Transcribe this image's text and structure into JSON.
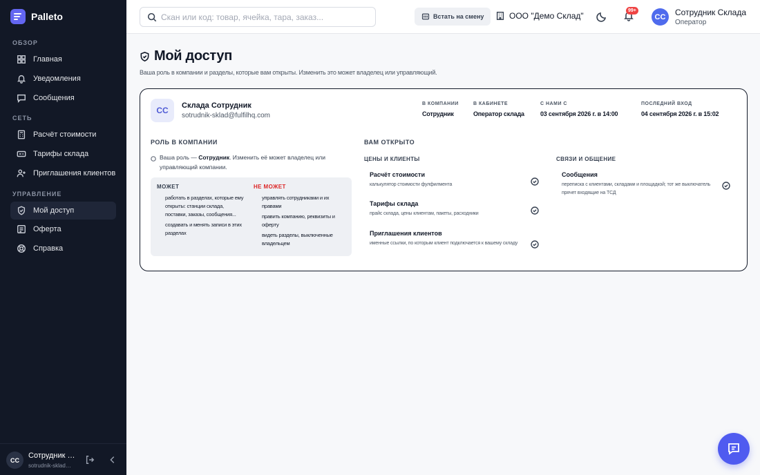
{
  "app": {
    "name": "Palleto"
  },
  "sidebar": {
    "sections": [
      {
        "title": "ОБЗОР",
        "items": [
          {
            "label": "Главная",
            "icon": "grid-icon"
          },
          {
            "label": "Уведомления",
            "icon": "bell-icon"
          },
          {
            "label": "Сообщения",
            "icon": "message-icon"
          }
        ]
      },
      {
        "title": "СЕТЬ",
        "items": [
          {
            "label": "Расчёт стоимости",
            "icon": "calculator-icon"
          },
          {
            "label": "Тарифы склада",
            "icon": "tariff-icon"
          },
          {
            "label": "Приглашения клиентов",
            "icon": "user-plus-icon"
          }
        ]
      },
      {
        "title": "УПРАВЛЕНИЕ",
        "items": [
          {
            "label": "Мой доступ",
            "icon": "shield-icon",
            "active": true
          },
          {
            "label": "Оферта",
            "icon": "document-icon"
          },
          {
            "label": "Справка",
            "icon": "help-icon"
          }
        ]
      }
    ],
    "footer": {
      "initials": "CC",
      "name": "Сотрудник Склада",
      "email": "sotrudnik-sklad@fulfilhq.com"
    }
  },
  "header": {
    "search_placeholder": "Скан или код: товар, ячейка, тара, заказ...",
    "shift_label": "Встать на смену",
    "org_name": "ООО \"Демо Склад\"",
    "notifications_badge": "99+",
    "user_initials": "CC",
    "user_name": "Сотрудник Склада",
    "user_role": "Оператор"
  },
  "page": {
    "title": "Мой доступ",
    "subtitle": "Ваша роль в компании и разделы, которые вам открыты. Изменить это может владелец или управляющий."
  },
  "profile": {
    "initials": "CC",
    "name": "Склада Сотрудник",
    "email": "sotrudnik-sklad@fulfilhq.com",
    "meta": [
      {
        "label": "В КОМПАНИИ",
        "value": "Сотрудник"
      },
      {
        "label": "В КАБИНЕТЕ",
        "value": "Оператор склада"
      },
      {
        "label": "С НАМИ С",
        "value": "03 сентября 2026 г. в 14:00"
      },
      {
        "label": "ПОСЛЕДНИЙ ВХОД",
        "value": "04 сентября 2026 г. в 15:02"
      }
    ]
  },
  "role": {
    "title": "РОЛЬ В КОМПАНИИ",
    "note_prefix": "Ваша роль — ",
    "note_role": "Сотрудник",
    "note_suffix": ". Изменить её может владелец или управляющий компании.",
    "can_title": "МОЖЕТ",
    "can": [
      "работать в разделах, которые ему открыты: станции склада, поставки, заказы, сообщения...",
      "создавать и менять записи в этих разделах"
    ],
    "cannot_title": "НЕ МОЖЕТ",
    "cannot": [
      "управлять сотрудниками и их правами",
      "править компанию, реквизиты и оферту",
      "видеть разделы, выключенные владельцем"
    ]
  },
  "access": {
    "title": "ВАМ ОТКРЫТО",
    "groups": [
      {
        "title": "ЦЕНЫ И КЛИЕНТЫ",
        "items": [
          {
            "name": "Расчёт стоимости",
            "desc": "калькулятор стоимости фулфилмента"
          },
          {
            "name": "Тарифы склада",
            "desc": "прайс склада, цены клиентам, пакеты, расходники"
          },
          {
            "name": "Приглашения клиентов",
            "desc": "именные ссылки, по которым клиент подключается к вашему складу"
          }
        ]
      },
      {
        "title": "СВЯЗИ И ОБЩЕНИЕ",
        "items": [
          {
            "name": "Сообщения",
            "desc": "переписка с клиентами, складами и площадкой; тот же выключатель прячет входящие на ТСД"
          }
        ]
      }
    ]
  }
}
